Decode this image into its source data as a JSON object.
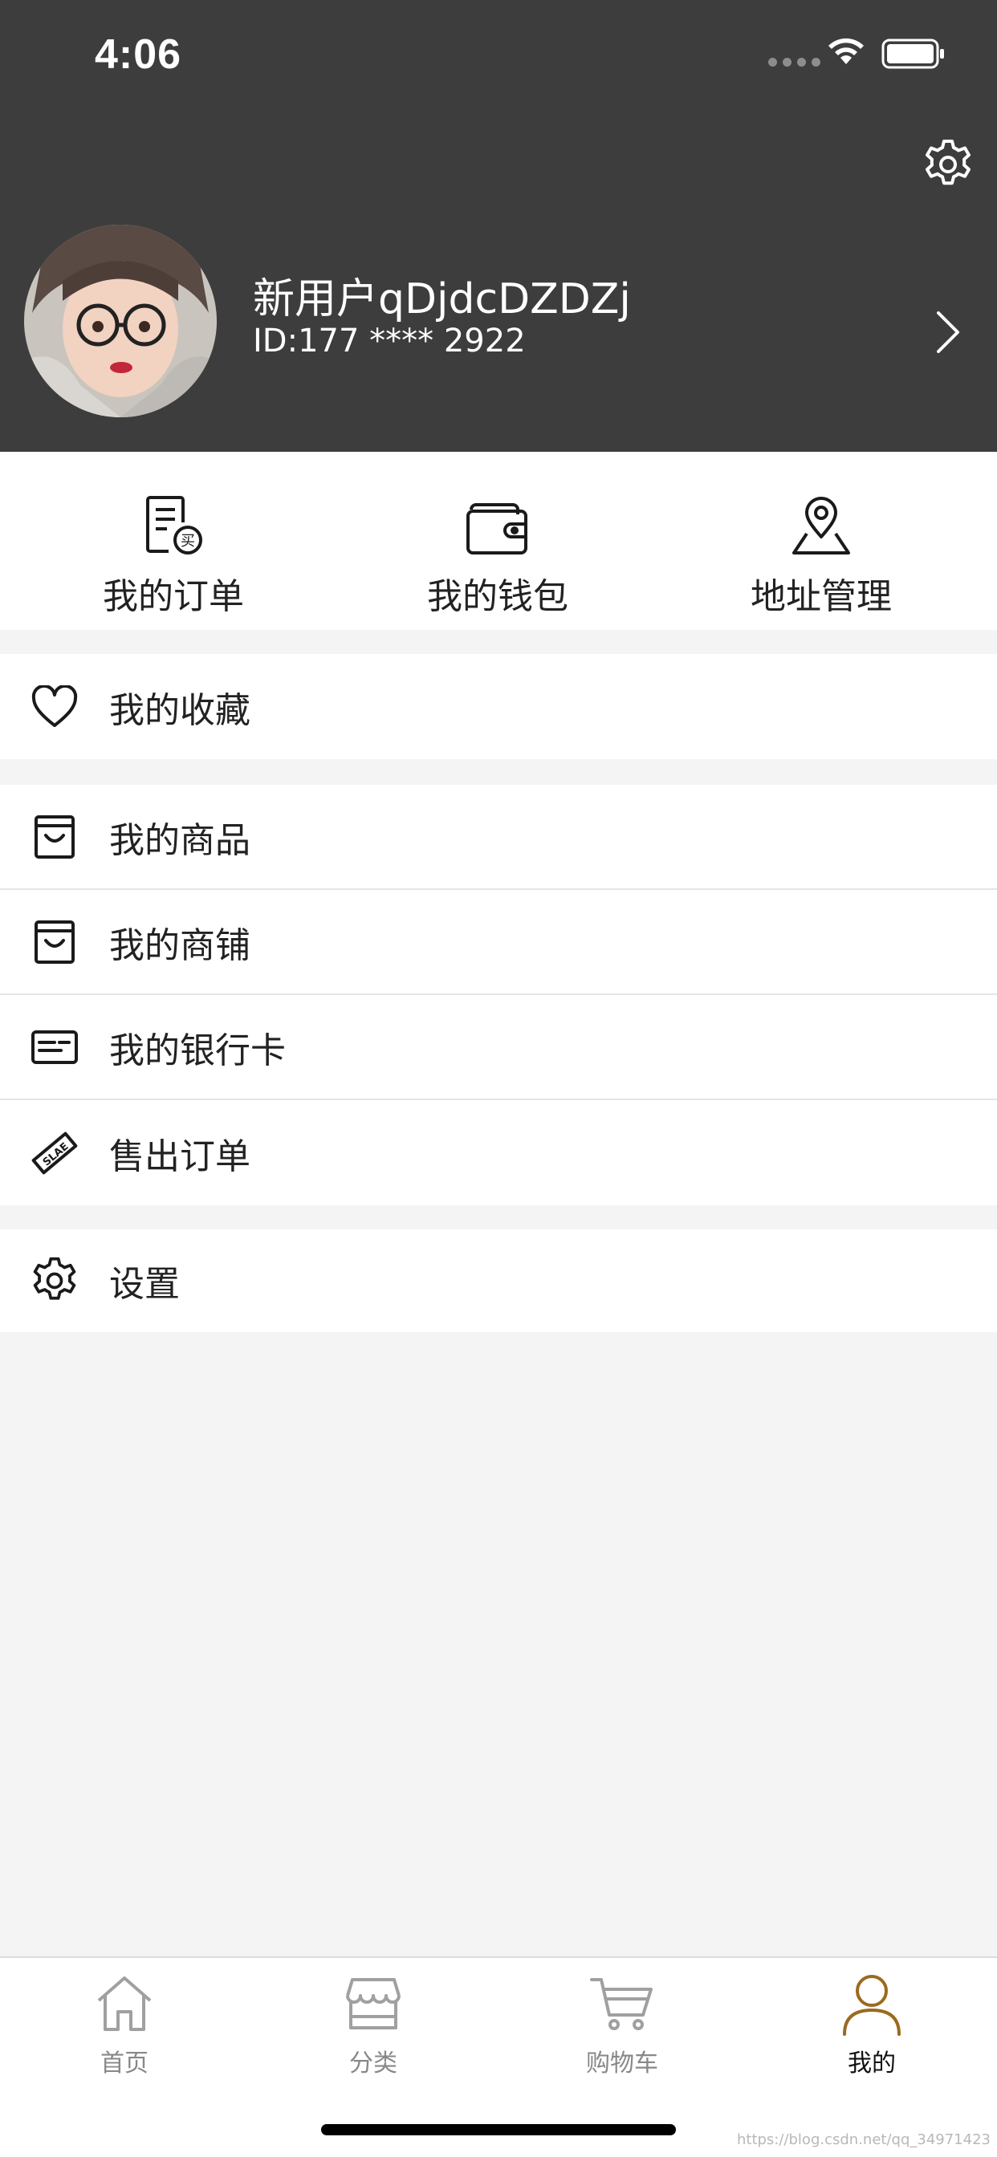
{
  "status_bar": {
    "time": "4:06"
  },
  "profile": {
    "name": "新用户qDjdcDZDZj",
    "id": "ID:177 **** 2922"
  },
  "quick_actions": [
    {
      "label": "我的订单",
      "icon": "order-list-icon"
    },
    {
      "label": "我的钱包",
      "icon": "wallet-icon"
    },
    {
      "label": "地址管理",
      "icon": "location-pin-icon"
    }
  ],
  "menu": {
    "favorites": "我的收藏",
    "my_products": "我的商品",
    "my_shop": "我的商铺",
    "bank_card": "我的银行卡",
    "sold_orders": "售出订单",
    "settings": "设置"
  },
  "tabbar": {
    "home": "首页",
    "category": "分类",
    "cart": "购物车",
    "mine": "我的",
    "active_color": "#9a6a1f"
  },
  "watermark": "https://blog.csdn.net/qq_34971423"
}
